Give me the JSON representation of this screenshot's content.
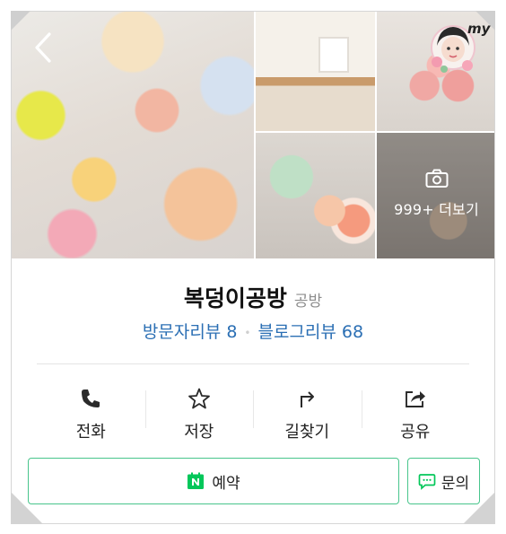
{
  "gallery": {
    "more_label": "999+ 더보기",
    "photos": [
      "candles-main-photo",
      "workshop-room-photo",
      "bubble-candle-photo",
      "ornament-photo",
      "more-photos"
    ]
  },
  "badge": {
    "text": "my"
  },
  "place": {
    "name": "복덩이공방",
    "category": "공방"
  },
  "reviews": {
    "visitor": "방문자리뷰 8",
    "blog": "블로그리뷰 68",
    "separator": "•"
  },
  "actions": [
    {
      "label": "전화",
      "icon": "phone-icon"
    },
    {
      "label": "저장",
      "icon": "star-icon"
    },
    {
      "label": "길찾기",
      "icon": "directions-icon"
    },
    {
      "label": "공유",
      "icon": "share-icon"
    }
  ],
  "buttons": {
    "reserve_label": "예약",
    "ask_label": "문의"
  },
  "colors": {
    "link_blue": "#2b6fb4",
    "naver_green": "#03c75a",
    "border_green": "#48c58c"
  }
}
